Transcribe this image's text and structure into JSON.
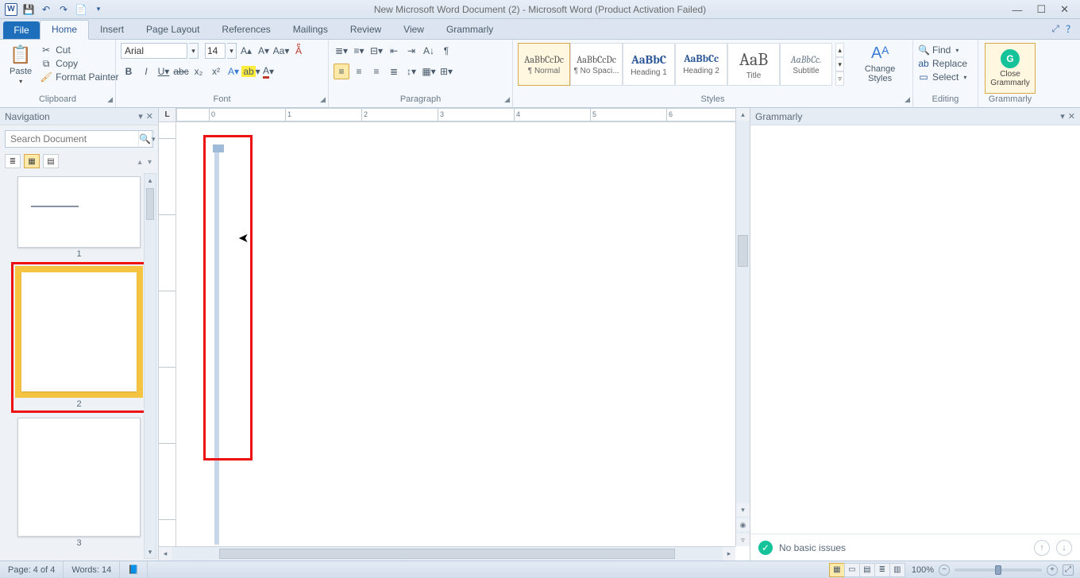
{
  "title": "New Microsoft Word Document (2)  -  Microsoft Word (Product Activation Failed)",
  "qat_word_letter": "W",
  "tabs": {
    "file": "File",
    "list": [
      "Home",
      "Insert",
      "Page Layout",
      "References",
      "Mailings",
      "Review",
      "View",
      "Grammarly"
    ],
    "active": "Home"
  },
  "clipboard": {
    "paste": "Paste",
    "cut": "Cut",
    "copy": "Copy",
    "format_painter": "Format Painter",
    "group": "Clipboard"
  },
  "font": {
    "name": "Arial",
    "size": "14",
    "group": "Font"
  },
  "paragraph": {
    "group": "Paragraph"
  },
  "styles": {
    "tiles": [
      {
        "sample": "AaBbCcDc",
        "name": "¶ Normal",
        "selected": true,
        "cls": "norm"
      },
      {
        "sample": "AaBbCcDc",
        "name": "¶ No Spaci...",
        "selected": false,
        "cls": "norm"
      },
      {
        "sample": "AaBbC",
        "name": "Heading 1",
        "selected": false,
        "cls": "h1"
      },
      {
        "sample": "AaBbCc",
        "name": "Heading 2",
        "selected": false,
        "cls": "h2"
      },
      {
        "sample": "AaB",
        "name": "Title",
        "selected": false,
        "cls": "title"
      },
      {
        "sample": "AaBbCc.",
        "name": "Subtitle",
        "selected": false,
        "cls": "sub"
      }
    ],
    "change": "Change Styles",
    "group": "Styles"
  },
  "editing": {
    "find": "Find",
    "replace": "Replace",
    "select": "Select",
    "group": "Editing"
  },
  "grammarly_group": {
    "close": "Close Grammarly",
    "group": "Grammarly"
  },
  "nav": {
    "title": "Navigation",
    "placeholder": "Search Document",
    "page_nums": [
      "1",
      "2",
      "3"
    ]
  },
  "gram_pane": {
    "title": "Grammarly",
    "status": "No basic issues"
  },
  "ruler_corner": "L",
  "status": {
    "page": "Page: 4 of 4",
    "words": "Words: 14",
    "zoom": "100%"
  }
}
